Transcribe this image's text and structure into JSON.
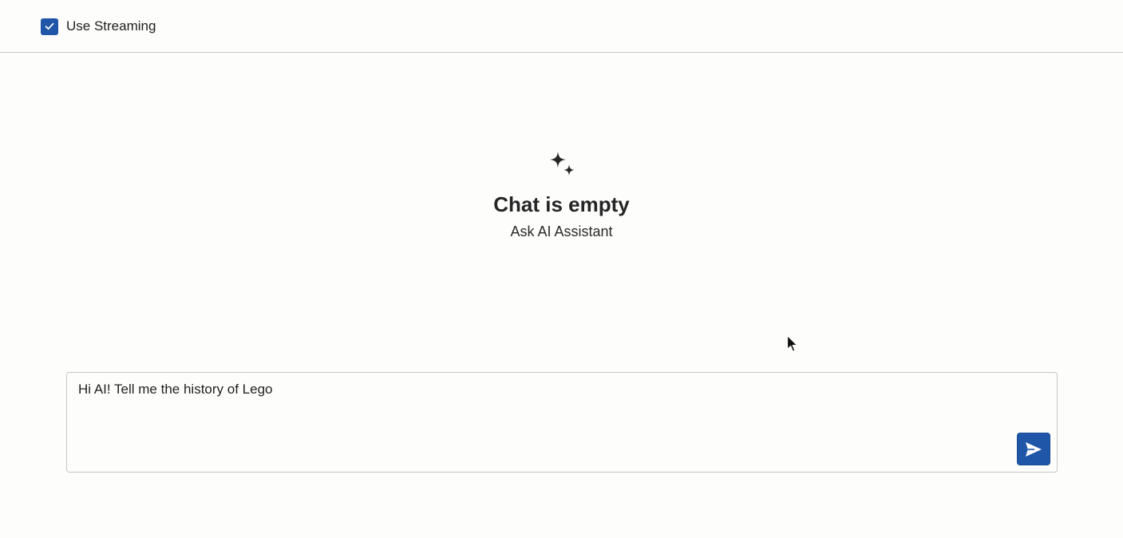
{
  "toolbar": {
    "streaming": {
      "label": "Use Streaming",
      "checked": true,
      "icon": "check-icon"
    }
  },
  "empty_state": {
    "icon": "sparkle-icon",
    "title": "Chat is empty",
    "subtitle": "Ask AI Assistant"
  },
  "composer": {
    "value": "Hi AI! Tell me the history of Lego",
    "send_icon": "send-icon"
  },
  "colors": {
    "accent": "#1f56a8",
    "background": "#fdfdfc",
    "border": "#c6c6c6",
    "text": "#1f1f1f"
  }
}
